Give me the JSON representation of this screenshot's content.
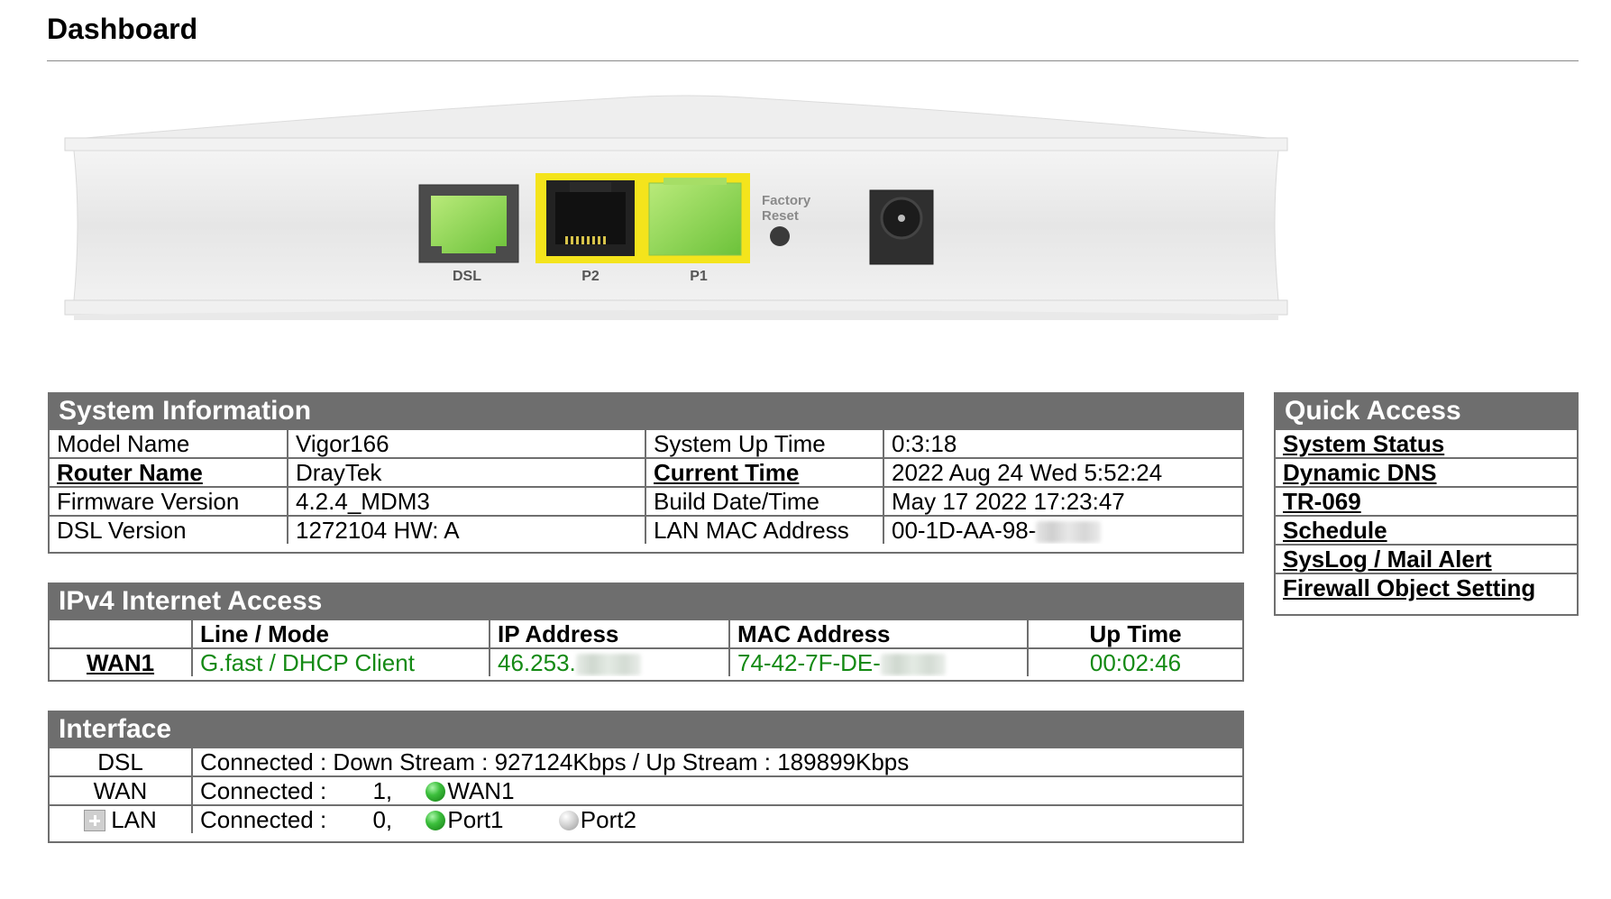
{
  "page": {
    "title": "Dashboard"
  },
  "device": {
    "ports": {
      "dsl": "DSL",
      "p2": "P2",
      "p1": "P1"
    },
    "factory_reset_line1": "Factory",
    "factory_reset_line2": "Reset"
  },
  "system_info": {
    "header": "System Information",
    "rows": [
      {
        "label": "Model Name",
        "value": "Vigor166",
        "label2": "System Up Time",
        "value2": "0:3:18"
      },
      {
        "label": "Router Name",
        "value": "DrayTek",
        "label2": "Current Time",
        "value2": "2022 Aug 24 Wed 5:52:24"
      },
      {
        "label": "Firmware Version",
        "value": "4.2.4_MDM3",
        "label2": "Build Date/Time",
        "value2": "May 17 2022 17:23:47"
      },
      {
        "label": "DSL Version",
        "value": "1272104 HW: A",
        "label2": "LAN MAC Address",
        "value2": "00-1D-AA-98-"
      }
    ]
  },
  "ipv4": {
    "header": "IPv4 Internet Access",
    "columns": [
      "",
      "Line / Mode",
      "IP Address",
      "MAC Address",
      "Up Time"
    ],
    "rows": [
      {
        "name": "WAN1",
        "mode": "G.fast / DHCP Client",
        "ip": "46.253.",
        "mac": "74-42-7F-DE-",
        "uptime": "00:02:46"
      }
    ]
  },
  "interface": {
    "header": "Interface",
    "dsl": {
      "label": "DSL",
      "status": "Connected : Down Stream : 927124Kbps / Up Stream : 189899Kbps"
    },
    "wan": {
      "label": "WAN",
      "status": "Connected :",
      "count": "1,",
      "port": "WAN1"
    },
    "lan": {
      "label": "LAN",
      "status": "Connected :",
      "count": "0,",
      "port1": "Port1",
      "port2": "Port2"
    }
  },
  "quick_access": {
    "header": "Quick Access",
    "items": [
      "System Status",
      "Dynamic DNS",
      "TR-069",
      "Schedule",
      "SysLog / Mail Alert",
      "Firewall Object Setting"
    ]
  },
  "colors": {
    "header_bg": "#6e6e6e",
    "status_green": "#148a14",
    "port_green": "#8fd14f",
    "port_yellow": "#f4e41c"
  }
}
